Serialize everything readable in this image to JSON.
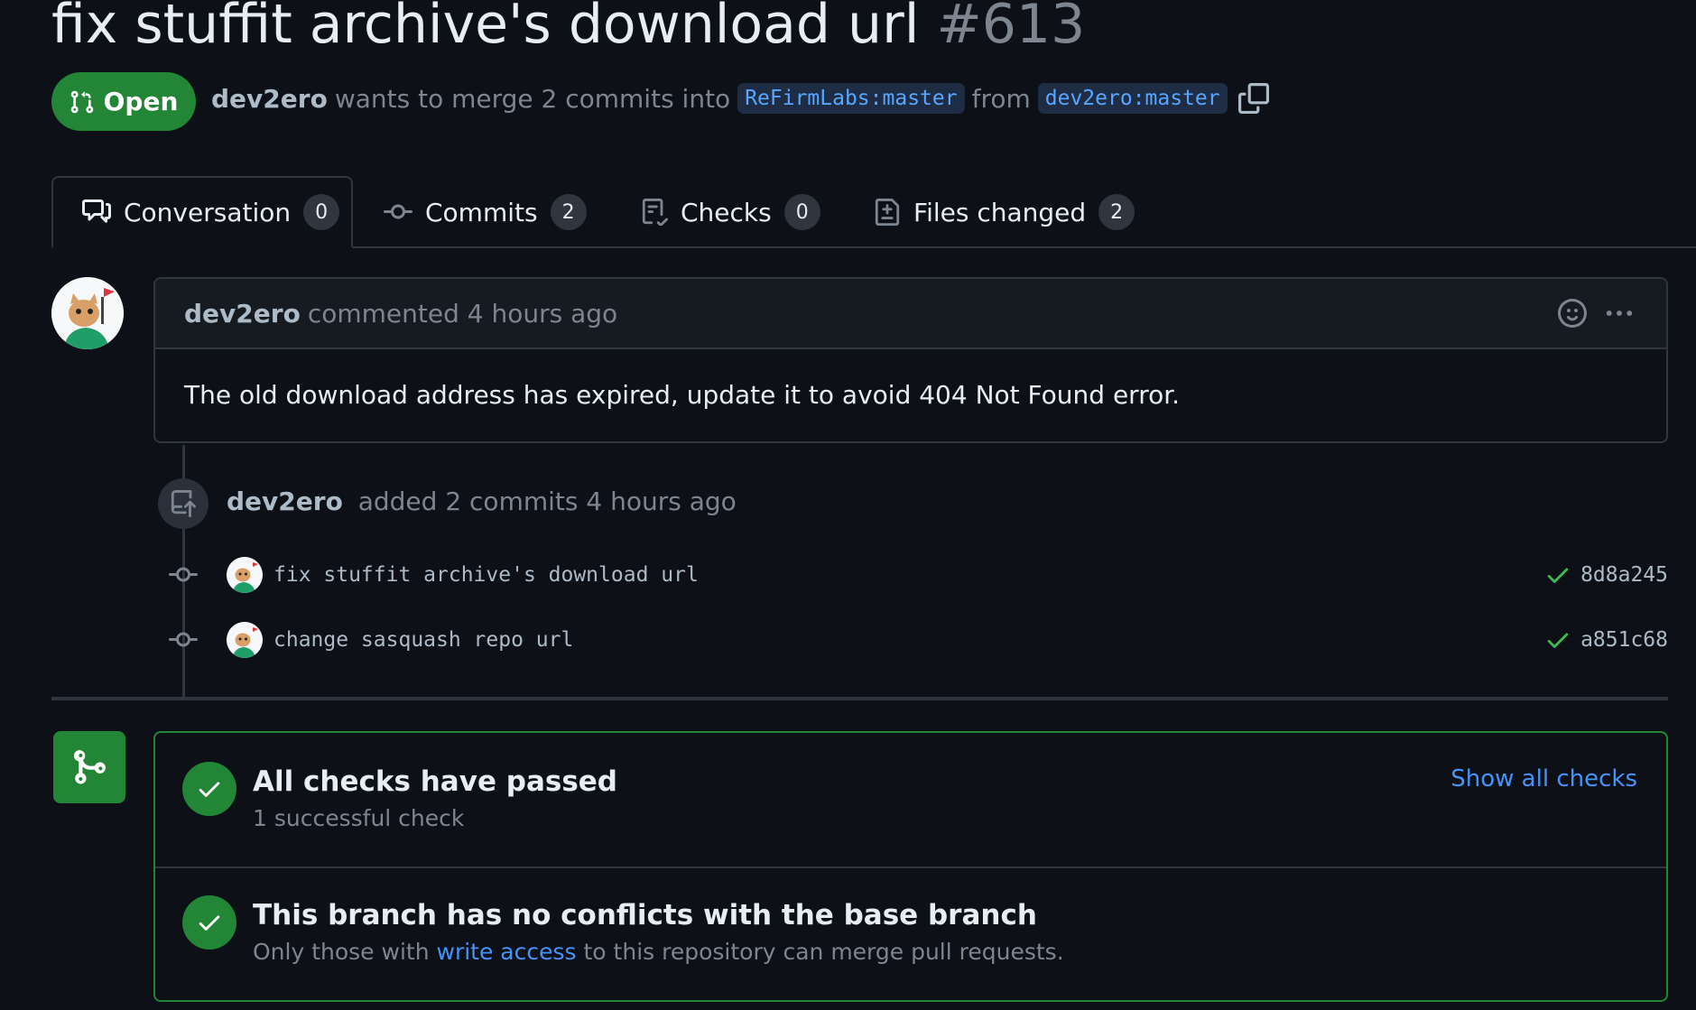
{
  "pr": {
    "title": "fix stuffit archive's download url",
    "number": "#613",
    "state": "Open",
    "author": "dev2ero",
    "merge_text": "wants to merge 2 commits into",
    "base_branch": "ReFirmLabs:master",
    "from_text": "from",
    "head_branch": "dev2ero:master"
  },
  "tabs": [
    {
      "label": "Conversation",
      "count": "0"
    },
    {
      "label": "Commits",
      "count": "2"
    },
    {
      "label": "Checks",
      "count": "0"
    },
    {
      "label": "Files changed",
      "count": "2"
    }
  ],
  "comment": {
    "author": "dev2ero",
    "action": "commented 4 hours ago",
    "body": "The old download address has expired, update it to avoid 404 Not Found error."
  },
  "event": {
    "author": "dev2ero",
    "text": "added 2 commits 4 hours ago"
  },
  "commits": [
    {
      "message": "fix stuffit archive's download url",
      "sha": "8d8a245"
    },
    {
      "message": "change sasquash repo url",
      "sha": "a851c68"
    }
  ],
  "merge": {
    "checks_title": "All checks have passed",
    "checks_sub": "1 successful check",
    "show_checks": "Show all checks",
    "conflict_title": "This branch has no conflicts with the base branch",
    "conflict_sub_pre": "Only those with",
    "conflict_link": "write access",
    "conflict_sub_post": "to this repository can merge pull requests."
  },
  "colors": {
    "accent_green": "#238636",
    "link_blue": "#4493f8",
    "background": "#0d1117"
  }
}
